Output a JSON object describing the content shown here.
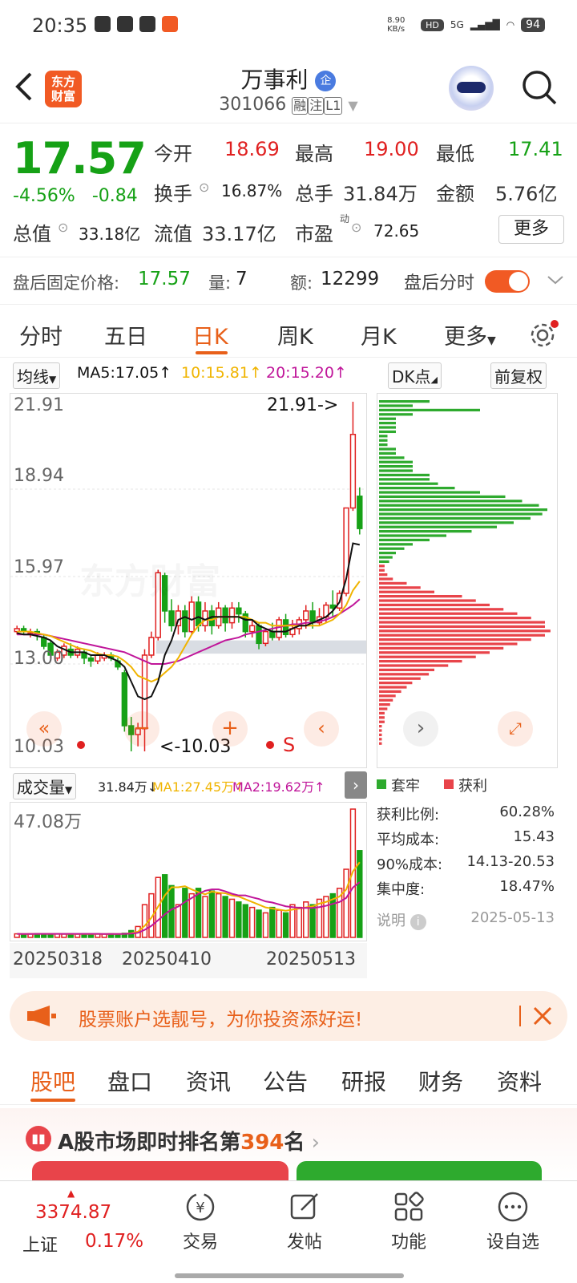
{
  "status_bar": {
    "time": "20:35",
    "net_speed": "8.90 KB/s",
    "signal": "5G",
    "battery": "94"
  },
  "header": {
    "logo_text_1": "东方",
    "logo_text_2": "财富",
    "stock_name": "万事利",
    "corp_badge": "企",
    "stock_code": "301066",
    "tags": [
      "融",
      "注",
      "L1"
    ]
  },
  "quote": {
    "price": "17.57",
    "change_pct": "-4.56%",
    "change_abs": "-0.84",
    "open_label": "今开",
    "open": "18.69",
    "high_label": "最高",
    "high": "19.00",
    "low_label": "最低",
    "low": "17.41",
    "turnover_label": "换手",
    "turnover": "16.87%",
    "volume_label": "总手",
    "volume": "31.84万",
    "amount_label": "金额",
    "amount": "5.76亿",
    "mktcap_label": "总值",
    "mktcap": "33.18亿",
    "float_label": "流值",
    "float": "33.17亿",
    "pe_label": "市盈",
    "pe_sup": "动",
    "pe": "72.65",
    "more_label": "更多"
  },
  "after_hours": {
    "price_label": "盘后固定价格:",
    "price": "17.57",
    "vol_label": "量:",
    "vol": "7",
    "amt_label": "额:",
    "amt": "12299",
    "toggle_label": "盘后分时"
  },
  "tabs": [
    "分时",
    "五日",
    "日K",
    "周K",
    "月K",
    "更多"
  ],
  "kline": {
    "ma_select": "均线",
    "ma5": "MA5:17.05",
    "ma10": "10:15.81",
    "ma20": "20:15.20",
    "dk_label": "DK点",
    "fq_label": "前复权",
    "y_ticks": [
      "21.91",
      "18.94",
      "15.97",
      "13.00",
      "10.03"
    ],
    "max_label": "21.91->",
    "min_label": "<-10.03",
    "s_label": "S",
    "watermark": "东方财富"
  },
  "volume": {
    "select": "成交量",
    "cur": "31.84万",
    "ma1": "MA1:27.45万",
    "ma2": "MA2:19.62万",
    "y_tick": "47.08万",
    "dates": [
      "20250318",
      "20250410",
      "20250513"
    ]
  },
  "chips": {
    "legend_trapped": "套牢",
    "legend_profit": "获利",
    "rows": [
      {
        "label": "获利比例:",
        "value": "60.28%"
      },
      {
        "label": "平均成本:",
        "value": "15.43"
      },
      {
        "label": "90%成本:",
        "value": "14.13-20.53"
      },
      {
        "label": "集中度:",
        "value": "18.47%"
      }
    ],
    "note_label": "说明",
    "date": "2025-05-13"
  },
  "banner": {
    "text": "股票账户选靓号，为你投资添好运!"
  },
  "subtabs": [
    "股吧",
    "盘口",
    "资讯",
    "公告",
    "研报",
    "财务",
    "资料"
  ],
  "rank": {
    "prefix": "A股市场即时排名第",
    "num": "394",
    "suffix": "名"
  },
  "bottom_nav": {
    "index_value": "3374.87",
    "index_name": "上证",
    "index_pct": "0.17%",
    "items": [
      "交易",
      "发帖",
      "功能",
      "设自选"
    ]
  },
  "colors": {
    "up": "#e02020",
    "down": "#16a116",
    "accent": "#e8601a",
    "ma5": "#111111",
    "ma10": "#f0b400",
    "ma20": "#c0169a"
  },
  "chart_data": {
    "type": "candlestick",
    "ylim": [
      10.03,
      21.91
    ],
    "candles": [
      [
        14.1,
        14.2,
        14.0,
        14.3
      ],
      [
        14.2,
        14.1,
        14.0,
        14.3
      ],
      [
        14.0,
        14.05,
        13.9,
        14.2
      ],
      [
        14.1,
        14.0,
        13.8,
        14.2
      ],
      [
        13.9,
        13.6,
        13.5,
        14.0
      ],
      [
        13.7,
        13.3,
        13.2,
        13.8
      ],
      [
        13.2,
        13.4,
        13.1,
        13.5
      ],
      [
        13.3,
        13.6,
        13.2,
        13.7
      ],
      [
        13.5,
        13.3,
        13.2,
        13.7
      ],
      [
        13.3,
        13.5,
        13.2,
        13.6
      ],
      [
        13.4,
        13.2,
        13.0,
        13.5
      ],
      [
        13.2,
        13.1,
        12.9,
        13.3
      ],
      [
        13.1,
        13.3,
        13.0,
        13.4
      ],
      [
        13.2,
        13.3,
        13.1,
        13.4
      ],
      [
        13.3,
        13.2,
        13.1,
        13.4
      ],
      [
        13.1,
        12.9,
        12.8,
        13.2
      ],
      [
        12.7,
        10.9,
        10.7,
        12.8
      ],
      [
        10.9,
        10.6,
        10.03,
        11.2
      ],
      [
        10.6,
        10.8,
        10.2,
        11.0
      ],
      [
        10.8,
        13.3,
        10.03,
        13.5
      ],
      [
        13.3,
        13.9,
        13.2,
        14.1
      ],
      [
        13.9,
        16.1,
        13.8,
        16.2
      ],
      [
        16.0,
        14.8,
        14.4,
        16.1
      ],
      [
        14.8,
        14.3,
        14.1,
        15.2
      ],
      [
        14.3,
        14.8,
        14.0,
        15.0
      ],
      [
        14.8,
        14.1,
        13.9,
        15.0
      ],
      [
        14.1,
        15.1,
        14.0,
        15.3
      ],
      [
        15.1,
        14.3,
        14.1,
        15.3
      ],
      [
        14.3,
        14.8,
        14.1,
        15.1
      ],
      [
        14.8,
        14.3,
        14.0,
        15.0
      ],
      [
        14.3,
        14.9,
        14.2,
        15.1
      ],
      [
        14.9,
        14.4,
        14.1,
        15.0
      ],
      [
        14.4,
        14.9,
        14.2,
        15.1
      ],
      [
        14.9,
        14.7,
        14.4,
        15.1
      ],
      [
        14.7,
        14.1,
        13.9,
        14.8
      ],
      [
        14.1,
        14.3,
        13.9,
        14.5
      ],
      [
        14.3,
        13.7,
        13.5,
        14.4
      ],
      [
        13.7,
        14.1,
        13.6,
        14.2
      ],
      [
        14.1,
        13.9,
        13.8,
        14.4
      ],
      [
        13.9,
        14.5,
        13.8,
        14.6
      ],
      [
        14.5,
        14.0,
        13.9,
        14.7
      ],
      [
        14.0,
        14.2,
        13.9,
        14.5
      ],
      [
        14.2,
        14.5,
        14.0,
        14.6
      ],
      [
        14.5,
        14.8,
        14.2,
        15.0
      ],
      [
        14.8,
        14.4,
        14.2,
        15.1
      ],
      [
        14.4,
        14.6,
        14.3,
        14.9
      ],
      [
        14.6,
        15.0,
        14.4,
        15.1
      ],
      [
        15.0,
        14.9,
        14.6,
        15.5
      ],
      [
        14.9,
        15.4,
        14.8,
        15.5
      ],
      [
        15.4,
        18.3,
        15.3,
        18.3
      ],
      [
        18.3,
        20.8,
        18.2,
        21.91
      ],
      [
        18.7,
        17.6,
        17.4,
        19.0
      ]
    ],
    "ma5": [
      14.05,
      14.0,
      14.0,
      13.95,
      13.9,
      13.8,
      13.6,
      13.5,
      13.4,
      13.4,
      13.4,
      13.3,
      13.3,
      13.3,
      13.2,
      13.1,
      12.9,
      12.4,
      11.9,
      11.8,
      11.9,
      12.4,
      13.3,
      13.8,
      14.5,
      14.6,
      14.5,
      14.6,
      14.5,
      14.6,
      14.6,
      14.6,
      14.6,
      14.6,
      14.5,
      14.5,
      14.3,
      14.2,
      14.1,
      14.1,
      14.1,
      14.2,
      14.3,
      14.3,
      14.4,
      14.5,
      14.6,
      14.8,
      15.1,
      15.9,
      17.1,
      17.05
    ],
    "ma10": [
      14.1,
      14.1,
      14.1,
      14.05,
      14.0,
      13.95,
      13.85,
      13.75,
      13.65,
      13.55,
      13.5,
      13.45,
      13.35,
      13.3,
      13.3,
      13.25,
      13.1,
      12.9,
      12.6,
      12.5,
      12.4,
      12.5,
      12.7,
      12.9,
      13.2,
      13.6,
      14.0,
      14.3,
      14.5,
      14.5,
      14.6,
      14.6,
      14.6,
      14.6,
      14.6,
      14.5,
      14.4,
      14.4,
      14.3,
      14.3,
      14.3,
      14.3,
      14.3,
      14.3,
      14.3,
      14.3,
      14.4,
      14.5,
      14.7,
      15.0,
      15.5,
      15.81
    ],
    "ma20": [
      14.0,
      14.0,
      14.0,
      14.0,
      14.0,
      13.95,
      13.9,
      13.85,
      13.8,
      13.75,
      13.7,
      13.65,
      13.6,
      13.55,
      13.5,
      13.45,
      13.4,
      13.3,
      13.2,
      13.1,
      13.0,
      13.0,
      13.0,
      13.05,
      13.1,
      13.2,
      13.3,
      13.4,
      13.5,
      13.6,
      13.7,
      13.8,
      13.85,
      13.9,
      14.0,
      14.05,
      14.1,
      14.15,
      14.2,
      14.25,
      14.3,
      14.35,
      14.35,
      14.4,
      14.4,
      14.45,
      14.5,
      14.6,
      14.7,
      14.85,
      15.0,
      15.2
    ],
    "volumes": [
      1.3,
      1.2,
      1.3,
      1.4,
      1.3,
      1.2,
      1.3,
      1.2,
      1.3,
      1.2,
      1.3,
      1.2,
      1.3,
      1.2,
      1.3,
      1.2,
      1.5,
      2.5,
      4.0,
      12.0,
      16.0,
      22.0,
      23.0,
      19.0,
      12.0,
      18.0,
      16.0,
      18.0,
      15.0,
      17.0,
      16.0,
      15.0,
      14.0,
      13.0,
      12.0,
      11.0,
      10.0,
      9.0,
      11.0,
      10.0,
      9.0,
      12.0,
      11.0,
      13.0,
      12.0,
      14.0,
      15.0,
      16.0,
      18.0,
      25.0,
      47.08,
      31.84
    ],
    "vol_ylim": [
      0,
      47.08
    ],
    "chips_profit": [
      0.3,
      0.2,
      0.6,
      0.2,
      0.1,
      0.1,
      0.1,
      0.1,
      0.05,
      0.05,
      0.05,
      0.1,
      0.1,
      0.15,
      0.2,
      0.2,
      0.2,
      0.3,
      0.3,
      0.35,
      0.45,
      0.6,
      0.75,
      0.85,
      0.95,
      1.0,
      0.97,
      0.9,
      0.8,
      0.7,
      0.55,
      0.4,
      0.3,
      0.2,
      0.15,
      0.1,
      0.08,
      0.06
    ],
    "chips_trapped": [
      0.02,
      0.02,
      0.03,
      0.05,
      0.1,
      0.15,
      0.2,
      0.3,
      0.35,
      0.4,
      0.45,
      0.5,
      0.55,
      0.6,
      0.6,
      0.62,
      0.6,
      0.55,
      0.5,
      0.45,
      0.4,
      0.35,
      0.3,
      0.25,
      0.2,
      0.18,
      0.15,
      0.12,
      0.1,
      0.08,
      0.06,
      0.05,
      0.04,
      0.03,
      0.02,
      0.02,
      0.02,
      0.01,
      0.01,
      0.01,
      0.01,
      0.01
    ]
  }
}
